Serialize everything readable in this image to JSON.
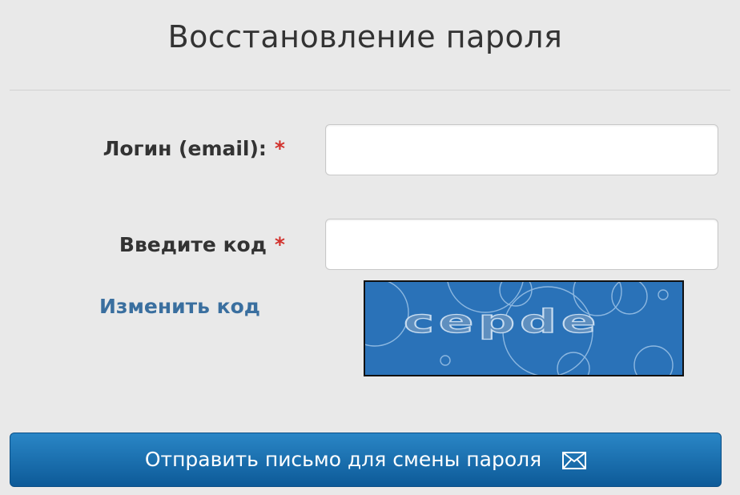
{
  "form": {
    "title": "Восстановление пароля",
    "login_label": "Логин (email):",
    "code_label": "Введите код",
    "required_mark": "*",
    "login_value": "",
    "code_value": "",
    "change_code_link": "Изменить код",
    "captcha_text": "cepde",
    "submit_label": "Отправить письмо для смены пароля",
    "submit_icon": "envelope-icon"
  },
  "colors": {
    "background": "#e9e9e9",
    "required": "#d2322d",
    "link": "#3a6f9f",
    "captcha_bg": "#2a72b8",
    "button": "#1a6fae"
  }
}
